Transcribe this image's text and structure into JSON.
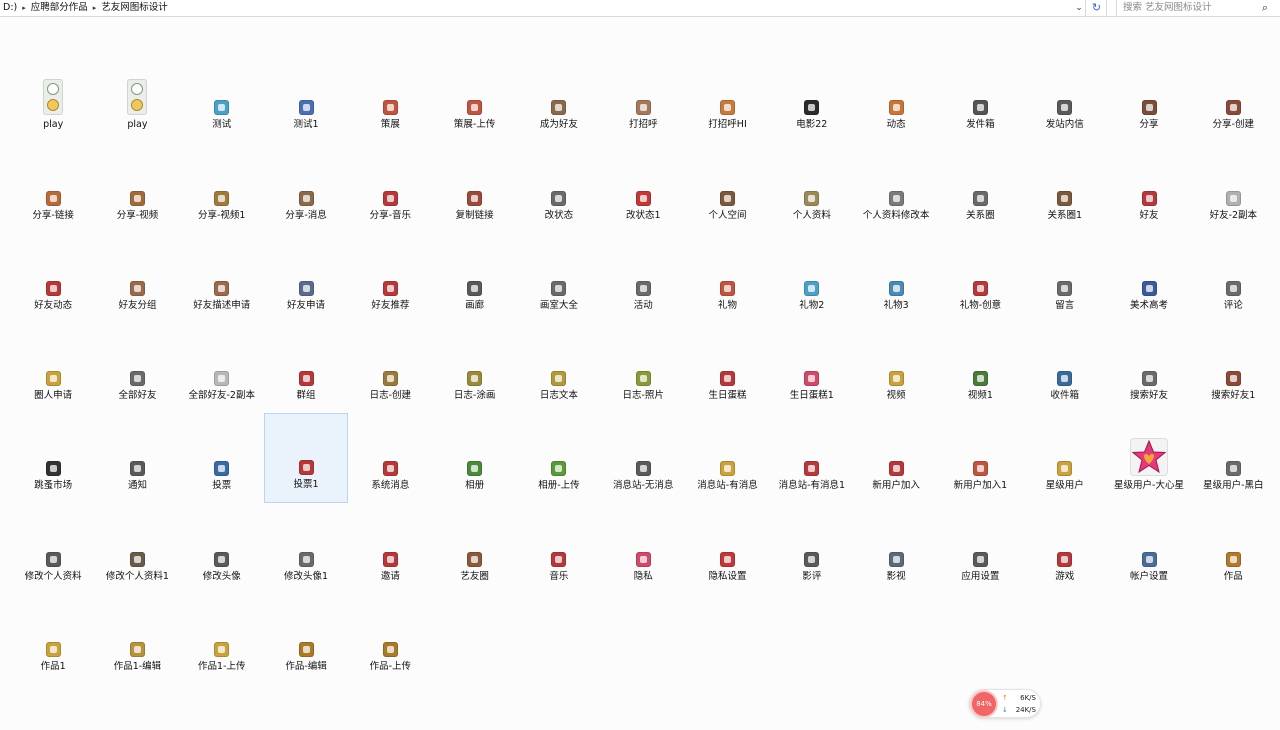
{
  "address": {
    "crumbs": [
      "D:)",
      "应聘部分作品",
      "艺友网图标设计"
    ],
    "separator": "▸",
    "dropdown_glyph": "⌄",
    "refresh_glyph": "↻"
  },
  "search": {
    "placeholder": "搜索 艺友网图标设计",
    "icon_glyph": "⌕"
  },
  "files": [
    {
      "name": "play",
      "icon": "play-stack",
      "color": "#c9a23d"
    },
    {
      "name": "play",
      "icon": "play-stack",
      "color": "#c9a23d"
    },
    {
      "name": "测试",
      "icon": "flask",
      "color": "#4aa0c5"
    },
    {
      "name": "测试1",
      "icon": "flask",
      "color": "#4a6fb5"
    },
    {
      "name": "策展",
      "icon": "house",
      "color": "#c0553f"
    },
    {
      "name": "策展-上传",
      "icon": "house",
      "color": "#c0553f"
    },
    {
      "name": "成为好友",
      "icon": "people",
      "color": "#8a6a4a"
    },
    {
      "name": "打招呼",
      "icon": "hand",
      "color": "#a5785a"
    },
    {
      "name": "打招呼HI",
      "icon": "speech",
      "color": "#c77a3a"
    },
    {
      "name": "电影22",
      "icon": "film",
      "color": "#2b2b2b"
    },
    {
      "name": "动态",
      "icon": "pulse",
      "color": "#c9753a"
    },
    {
      "name": "发件箱",
      "icon": "outbox",
      "color": "#555555"
    },
    {
      "name": "发站内信",
      "icon": "mail",
      "color": "#5a5a5a"
    },
    {
      "name": "分享",
      "icon": "share",
      "color": "#7a4f3a"
    },
    {
      "name": "分享-创建",
      "icon": "share",
      "color": "#8a4a3a"
    },
    {
      "name": "分享-链接",
      "icon": "link",
      "color": "#b56b3a"
    },
    {
      "name": "分享-视频",
      "icon": "video",
      "color": "#a06a3a"
    },
    {
      "name": "分享-视频1",
      "icon": "video",
      "color": "#a07a3a"
    },
    {
      "name": "分享-消息",
      "icon": "message",
      "color": "#8a6a4a"
    },
    {
      "name": "分享-音乐",
      "icon": "music",
      "color": "#b5393a"
    },
    {
      "name": "复制链接",
      "icon": "copy",
      "color": "#9a4a3a"
    },
    {
      "name": "改状态",
      "icon": "status",
      "color": "#6a6a6a"
    },
    {
      "name": "改状态1",
      "icon": "status",
      "color": "#c0393a"
    },
    {
      "name": "个人空间",
      "icon": "globe",
      "color": "#7a5a3a"
    },
    {
      "name": "个人资料",
      "icon": "profile",
      "color": "#9a8a5a"
    },
    {
      "name": "个人资料修改本",
      "icon": "edit-profile",
      "color": "#7a7a7a"
    },
    {
      "name": "关系圈",
      "icon": "circle",
      "color": "#6a6a6a"
    },
    {
      "name": "关系圈1",
      "icon": "circle",
      "color": "#7a5a3a"
    },
    {
      "name": "好友",
      "icon": "user",
      "color": "#b5393a"
    },
    {
      "name": "好友-2副本",
      "icon": "user",
      "color": "#b0b0b0"
    },
    {
      "name": "好友动态",
      "icon": "friend-feed",
      "color": "#b5393a"
    },
    {
      "name": "好友分组",
      "icon": "friend-group",
      "color": "#9a6a4a"
    },
    {
      "name": "好友描述申请",
      "icon": "friend-write",
      "color": "#9a6a4a"
    },
    {
      "name": "好友申请",
      "icon": "friend-request",
      "color": "#5a6a8a"
    },
    {
      "name": "好友推荐",
      "icon": "friend-recommend",
      "color": "#b5393a"
    },
    {
      "name": "画廊",
      "icon": "frame",
      "color": "#5a5a5a"
    },
    {
      "name": "画室大全",
      "icon": "easel",
      "color": "#6a6a6a"
    },
    {
      "name": "活动",
      "icon": "crowd",
      "color": "#6a6a6a"
    },
    {
      "name": "礼物",
      "icon": "gift",
      "color": "#c0553f"
    },
    {
      "name": "礼物2",
      "icon": "gift",
      "color": "#4aa0c5"
    },
    {
      "name": "礼物3",
      "icon": "gift",
      "color": "#4a8ab5"
    },
    {
      "name": "礼物-创意",
      "icon": "gift",
      "color": "#b5393a"
    },
    {
      "name": "留言",
      "icon": "speech",
      "color": "#6a6a6a"
    },
    {
      "name": "美术高考",
      "icon": "palette",
      "color": "#3a5a9a"
    },
    {
      "name": "评论",
      "icon": "speech",
      "color": "#6a6a6a"
    },
    {
      "name": "圈人申请",
      "icon": "circle-request",
      "color": "#c9a23d"
    },
    {
      "name": "全部好友",
      "icon": "people",
      "color": "#6a6a6a"
    },
    {
      "name": "全部好友-2副本",
      "icon": "people",
      "color": "#b8b8b8"
    },
    {
      "name": "群组",
      "icon": "group",
      "color": "#b5393a"
    },
    {
      "name": "日志-创建",
      "icon": "journal",
      "color": "#9a7a3a"
    },
    {
      "name": "日志-涂画",
      "icon": "journal",
      "color": "#9a8a3a"
    },
    {
      "name": "日志文本",
      "icon": "journal",
      "color": "#b09a3a"
    },
    {
      "name": "日志-照片",
      "icon": "journal",
      "color": "#8a9a3a"
    },
    {
      "name": "生日蛋糕",
      "icon": "cake",
      "color": "#b5393a"
    },
    {
      "name": "生日蛋糕1",
      "icon": "cake",
      "color": "#d04a6a"
    },
    {
      "name": "视频",
      "icon": "camera",
      "color": "#c9a23d"
    },
    {
      "name": "视频1",
      "icon": "video",
      "color": "#4a7a3a"
    },
    {
      "name": "收件箱",
      "icon": "inbox",
      "color": "#3a6a9a"
    },
    {
      "name": "搜索好友",
      "icon": "search-user",
      "color": "#6a6a6a"
    },
    {
      "name": "搜索好友1",
      "icon": "search-user",
      "color": "#8a4a3a"
    },
    {
      "name": "跳蚤市场",
      "icon": "cart",
      "color": "#333333"
    },
    {
      "name": "通知",
      "icon": "notice",
      "color": "#5a5a5a"
    },
    {
      "name": "投票",
      "icon": "bars",
      "color": "#3a6aa5"
    },
    {
      "name": "投票1",
      "icon": "bars",
      "color": "#b5393a",
      "selected": true
    },
    {
      "name": "系统消息",
      "icon": "megaphone",
      "color": "#b5393a"
    },
    {
      "name": "相册",
      "icon": "photo",
      "color": "#4a8a3a"
    },
    {
      "name": "相册-上传",
      "icon": "photo",
      "color": "#5a9a3a"
    },
    {
      "name": "消息站-无消息",
      "icon": "mail",
      "color": "#5a5a5a"
    },
    {
      "name": "消息站-有消息",
      "icon": "mail",
      "color": "#c9a23d"
    },
    {
      "name": "消息站-有消息1",
      "icon": "mail",
      "color": "#b5393a"
    },
    {
      "name": "新用户加入",
      "icon": "new-user",
      "color": "#b5393a"
    },
    {
      "name": "新用户加入1",
      "icon": "new-user",
      "color": "#c0553f"
    },
    {
      "name": "星级用户",
      "icon": "star-user",
      "color": "#c9a23d"
    },
    {
      "name": "星级用户-大心星",
      "icon": "big-star",
      "color": "#e23a7a",
      "big": true
    },
    {
      "name": "星级用户-黑白",
      "icon": "star-user",
      "color": "#6a6a6a"
    },
    {
      "name": "修改个人资料",
      "icon": "edit-profile",
      "color": "#5a5a5a"
    },
    {
      "name": "修改个人资料1",
      "icon": "edit-profile",
      "color": "#6a5a4a"
    },
    {
      "name": "修改头像",
      "icon": "avatar-edit",
      "color": "#5a5a5a"
    },
    {
      "name": "修改头像1",
      "icon": "avatar-edit",
      "color": "#6a6a6a"
    },
    {
      "name": "邀请",
      "icon": "invite",
      "color": "#b5393a"
    },
    {
      "name": "艺友圈",
      "icon": "target",
      "color": "#8a5a3a"
    },
    {
      "name": "音乐",
      "icon": "music-note",
      "color": "#b5393a"
    },
    {
      "name": "隐私",
      "icon": "privacy",
      "color": "#d04a6a"
    },
    {
      "name": "隐私设置",
      "icon": "privacy-settings",
      "color": "#c0393a"
    },
    {
      "name": "影评",
      "icon": "review",
      "color": "#5a5a5a"
    },
    {
      "name": "影视",
      "icon": "tv",
      "color": "#5a6a7a"
    },
    {
      "name": "应用设置",
      "icon": "app-settings",
      "color": "#5a5a5a"
    },
    {
      "name": "游戏",
      "icon": "game",
      "color": "#b5393a"
    },
    {
      "name": "帐户设置",
      "icon": "account-settings",
      "color": "#4a6a9a"
    },
    {
      "name": "作品",
      "icon": "works",
      "color": "#b07a2a"
    },
    {
      "name": "作品1",
      "icon": "works",
      "color": "#c9a23d"
    },
    {
      "name": "作品1-编辑",
      "icon": "works",
      "color": "#b8923d"
    },
    {
      "name": "作品1-上传",
      "icon": "works",
      "color": "#c9a23d"
    },
    {
      "name": "作品-编辑",
      "icon": "works",
      "color": "#a87a2a"
    },
    {
      "name": "作品-上传",
      "icon": "works",
      "color": "#a87a2a"
    }
  ],
  "net_widget": {
    "percent": "84%",
    "upload": "6K/S",
    "download": "24K/S",
    "up_glyph": "↑",
    "down_glyph": "↓"
  }
}
